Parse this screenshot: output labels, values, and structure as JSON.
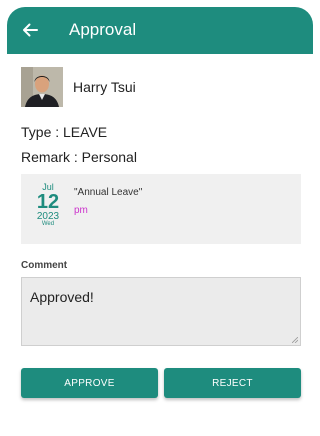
{
  "appbar": {
    "title": "Approval",
    "back_icon": "arrow-left-icon",
    "color": "#1e8c7e"
  },
  "user": {
    "name": "Harry Tsui",
    "avatar_icon": "user-photo"
  },
  "details": {
    "type_line": "Type : LEAVE",
    "remark_line": "Remark : Personal"
  },
  "leave": {
    "month": "Jul",
    "day": "12",
    "year": "2023",
    "weekday": "Wed",
    "type": "\"Annual Leave\"",
    "period": "pm",
    "period_color": "#cc33cc"
  },
  "comment": {
    "label": "Comment",
    "value": "Approved!"
  },
  "actions": {
    "approve_label": "APPROVE",
    "reject_label": "REJECT"
  }
}
